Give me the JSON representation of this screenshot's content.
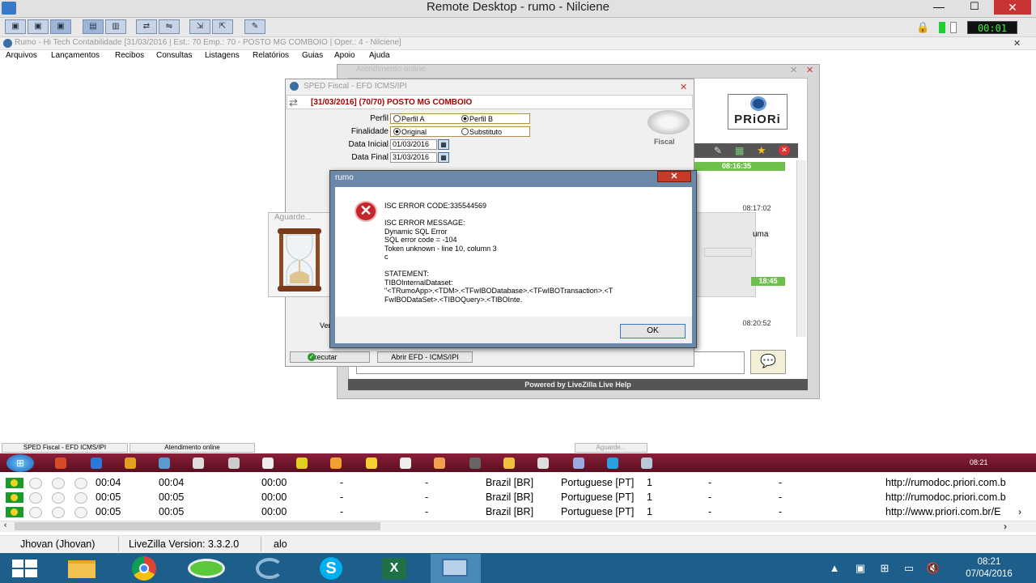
{
  "remote_desktop": {
    "title": "Remote Desktop - rumo - Nilciene",
    "timer": "00:01",
    "min_label": "—",
    "max_label": "☐",
    "close_label": "✕"
  },
  "rumo_app": {
    "title": "Rumo - Hi Tech Contabilidade [31/03/2016 | Est.: 70 Emp.: 70 - POSTO MG COMBOIO | Oper.: 4 - Nilciene]",
    "close_label": "✕",
    "menu": [
      "Arquivos",
      "Lançamentos",
      "Recibos",
      "Consultas",
      "Listagens",
      "Relatórios",
      "Guias",
      "Apoio",
      "Ajuda"
    ]
  },
  "atendimento": {
    "title": "Atendimento online",
    "brand": "PRiORi",
    "times": [
      "08:16:35",
      "08:17:02",
      "18:45",
      "08:20:52"
    ],
    "snippet": "uma",
    "powered_by": "Powered by LiveZilla Live Help"
  },
  "sped": {
    "title": "SPED Fiscal - EFD ICMS/IPI",
    "header": "[31/03/2016] (70/70) POSTO MG COMBOIO",
    "perfil_label": "Perfil",
    "perfil_a": "Perfil A",
    "perfil_b": "Perfil B",
    "finalidade_label": "Finalidade",
    "original": "Original",
    "substituto": "Substituto",
    "data_inicial_label": "Data Inicial",
    "data_inicial": "01/03/2016",
    "data_final_label": "Data Final",
    "data_final": "31/03/2016",
    "fiscal_label": "Fiscal",
    "executar": "Executar",
    "abrir": "Abrir EFD - ICMS/IPI",
    "ver_fragment": "Ver"
  },
  "aguarde": {
    "title": "Aguarde..."
  },
  "error_dialog": {
    "title": "rumo",
    "code": "ISC ERROR CODE:335544569",
    "message_label": "ISC ERROR MESSAGE:",
    "message_lines": [
      "Dynamic SQL Error",
      "SQL error code = -104",
      "Token unknown - line 10, column 3",
      "c"
    ],
    "statement_label": "STATEMENT:",
    "statement_lines": [
      "TIBOInternalDataset:",
      "\"<TRumoApp>.<TDM>.<TFwIBODatabase>.<TFwIBOTransaction>.<T",
      "FwIBODataSet>.<TIBOQuery>.<TIBOInte."
    ],
    "ok": "OK",
    "close_label": "✕"
  },
  "inner_tabs": [
    "SPED Fiscal - EFD ICMS/IPI",
    "Atendimento online",
    "Aguarde..."
  ],
  "inner_clock": "08:21",
  "visitors": [
    {
      "t1": "00:04",
      "t2": "00:04",
      "t3": "00:00",
      "d1": "-",
      "d2": "-",
      "country": "Brazil [BR]",
      "lang": "Portuguese [PT]",
      "n": "1",
      "d3": "-",
      "d4": "-",
      "url": "http://rumodoc.priori.com.b"
    },
    {
      "t1": "00:05",
      "t2": "00:05",
      "t3": "00:00",
      "d1": "-",
      "d2": "-",
      "country": "Brazil [BR]",
      "lang": "Portuguese [PT]",
      "n": "1",
      "d3": "-",
      "d4": "-",
      "url": "http://rumodoc.priori.com.b"
    },
    {
      "t1": "00:05",
      "t2": "00:05",
      "t3": "00:00",
      "d1": "-",
      "d2": "-",
      "country": "Brazil [BR]",
      "lang": "Portuguese [PT]",
      "n": "1",
      "d3": "-",
      "d4": "-",
      "url": "http://www.priori.com.br/E"
    }
  ],
  "statusbar": {
    "user": "Jhovan (Jhovan)",
    "version": "LiveZilla Version: 3.3.2.0",
    "status": "alo"
  },
  "taskbar": {
    "time": "08:21",
    "date": "07/04/2016",
    "apps": [
      "file-explorer",
      "chrome",
      "app-green",
      "app-blue",
      "skype",
      "excel",
      "remote-desktop"
    ]
  },
  "colors": {
    "taskbar": "#1d5f8a",
    "error_red": "#c4262e",
    "chat_green": "#6fc04a",
    "inner_taskbar": "#7a1a30"
  }
}
